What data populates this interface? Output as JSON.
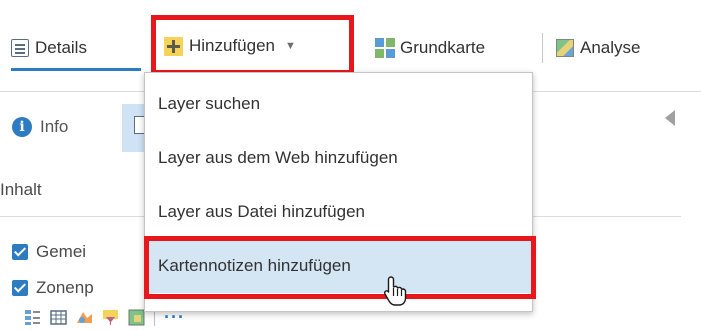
{
  "toolbar": {
    "details_label": "Details",
    "add_label": "Hinzufügen",
    "add_caret": "▼",
    "basemap_label": "Grundkarte",
    "analysis_label": "Analyse"
  },
  "panel": {
    "info_label": "Info",
    "content_heading": "Inhalt",
    "layers": [
      {
        "label": "Gemei",
        "checked": true
      },
      {
        "label": "Zonenp",
        "checked": true
      }
    ],
    "more_label": "···"
  },
  "dropdown": {
    "items": [
      {
        "label": "Layer suchen"
      },
      {
        "label": "Layer aus dem Web hinzufügen"
      },
      {
        "label": "Layer aus Datei hinzufügen"
      },
      {
        "label": "Kartennotizen hinzufügen",
        "highlighted": true
      }
    ]
  },
  "colors": {
    "accent": "#2d7cc2",
    "highlight_box": "#e8171c",
    "menu_hover": "#d4e5f4",
    "add_icon": "#f3d35a"
  },
  "icons": [
    "details-icon",
    "add-icon",
    "basemap-grid-icon",
    "analysis-icon",
    "info-icon",
    "collapse-arrow-icon",
    "hand-cursor-icon"
  ]
}
